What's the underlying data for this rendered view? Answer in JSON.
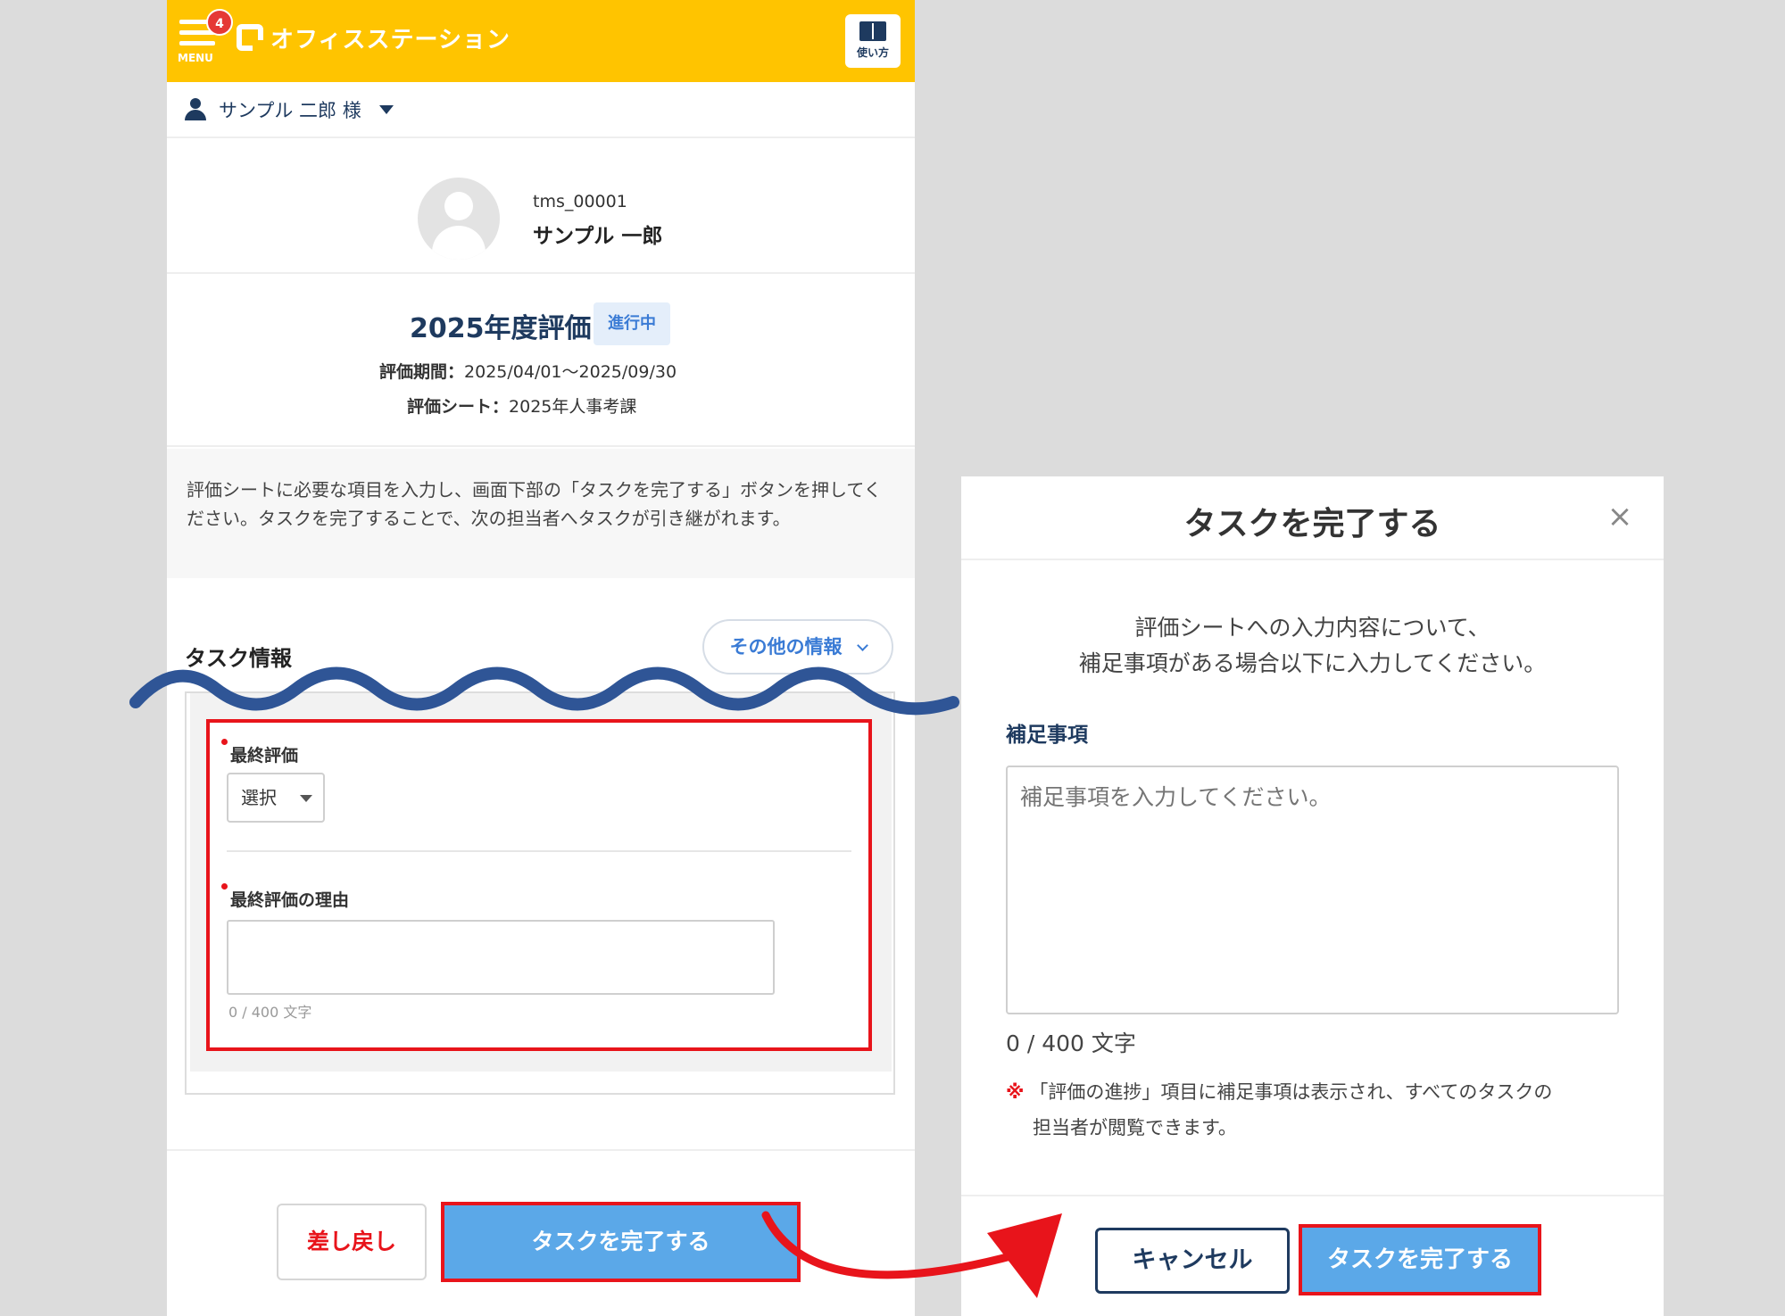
{
  "header": {
    "menu_label": "MENU",
    "badge_count": "4",
    "logo_text": "オフィスステーション",
    "help_label": "使い方",
    "brand_color": "#ffc400"
  },
  "user": {
    "name": "サンプル 二郎 様"
  },
  "profile": {
    "employee_id": "tms_00001",
    "employee_name": "サンプル 一郎"
  },
  "evaluation": {
    "title": "2025年度評価",
    "status": "進行中",
    "period_label": "評価期間：",
    "period_value": "2025/04/01～2025/09/30",
    "sheet_label": "評価シート：",
    "sheet_value": "2025年人事考課"
  },
  "notice": "評価シートに必要な項目を入力し、画面下部の「タスクを完了する」ボタンを押してください。タスクを完了することで、次の担当者へタスクが引き継がれます。",
  "task_info": {
    "heading": "タスク情報",
    "more_button": "その他の情報",
    "final_eval_label": "最終評価",
    "final_eval_select": "選択",
    "reason_label": "最終評価の理由",
    "reason_counter": "0 / 400 文字"
  },
  "footer": {
    "return_button": "差し戻し",
    "complete_button": "タスクを完了する"
  },
  "modal": {
    "title": "タスクを完了する",
    "close_icon": "×",
    "message_line1": "評価シートへの入力内容について、",
    "message_line2": "補足事項がある場合以下に入力してください。",
    "supplement_label": "補足事項",
    "supplement_placeholder": "補足事項を入力してください。",
    "supplement_counter": "0 / 400 文字",
    "note_mark": "※",
    "note_line1": "「評価の進捗」項目に補足事項は表示され、すべてのタスクの",
    "note_line2": "担当者が閲覧できます。",
    "cancel_button": "キャンセル",
    "complete_button": "タスクを完了する"
  },
  "colors": {
    "accent_blue": "#5ba8e8",
    "highlight_red": "#e8141b",
    "navy": "#1e3a5f",
    "wave_blue": "#2f5596"
  }
}
